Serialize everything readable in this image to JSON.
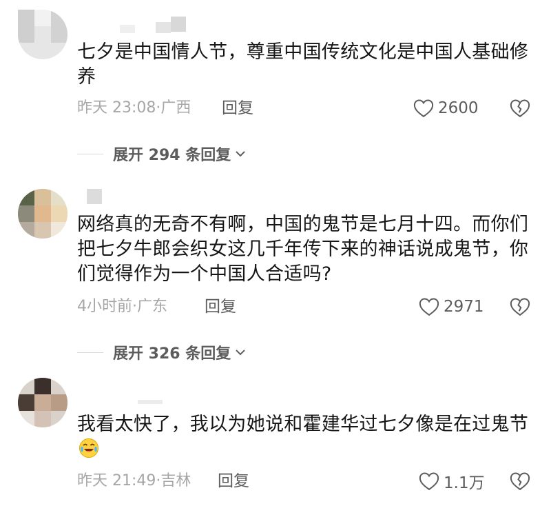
{
  "comments": [
    {
      "text": "七夕是中国情人节，尊重中国传统文化是中国人基础修养",
      "time_location": "昨天 23:08·广西",
      "reply_label": "回复",
      "likes": "2600",
      "expand_label": "展开 294 条回复"
    },
    {
      "text": "网络真的无奇不有啊，中国的鬼节是七月十四。而你们把七夕牛郎会织女这几千年传下来的神话说成鬼节，你们觉得作为一个中国人合适吗?",
      "time_location": "4小时前·广东",
      "reply_label": "回复",
      "likes": "2971",
      "expand_label": "展开 326 条回复"
    },
    {
      "text": "我看太快了，我以为她说和霍建华过七夕像是在过鬼节",
      "time_location": "昨天 21:49·吉林",
      "reply_label": "回复",
      "likes": "1.1万"
    }
  ],
  "colors": {
    "text": "#161616",
    "meta": "#a6a6a6",
    "action": "#5c5c5c"
  },
  "icons": {
    "like": "heart-outline-icon",
    "dislike": "broken-heart-icon",
    "expand": "chevron-down-icon",
    "emoji": "laughing-crying-emoji"
  }
}
